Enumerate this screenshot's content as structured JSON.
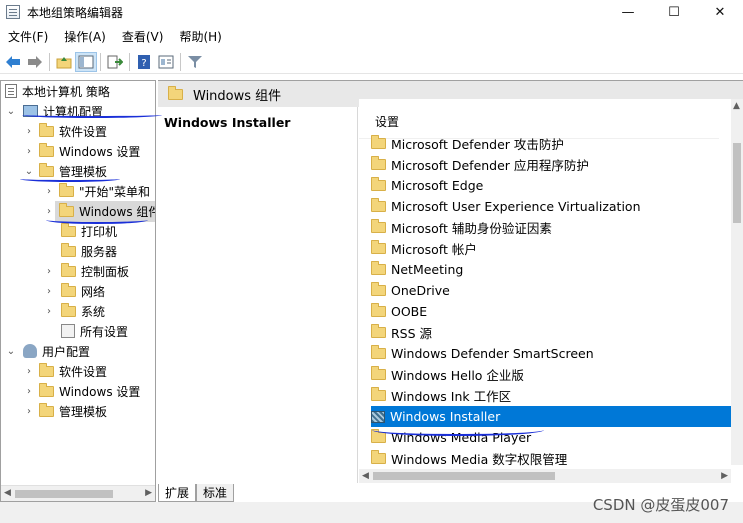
{
  "window": {
    "title": "本地组策略编辑器",
    "controls": [
      "—",
      "☐",
      "✕"
    ]
  },
  "menu": [
    "文件(F)",
    "操作(A)",
    "查看(V)",
    "帮助(H)"
  ],
  "toolbar": {
    "icons": [
      "back-arrow",
      "forward-arrow",
      "folder-up",
      "show-tree",
      "export-list",
      "help",
      "properties",
      "filter"
    ]
  },
  "tree": {
    "root": "本地计算机 策略",
    "computer_config": "计算机配置",
    "software_settings": "软件设置",
    "windows_settings": "Windows 设置",
    "admin_templates": "管理模板",
    "start_menu": "\"开始\"菜单和",
    "windows_components": "Windows 组件",
    "printers": "打印机",
    "server": "服务器",
    "control_panel": "控制面板",
    "network": "网络",
    "system": "系统",
    "all_settings": "所有设置",
    "user_config": "用户配置",
    "user_software_settings": "软件设置",
    "user_windows_settings": "Windows 设置",
    "user_admin_templates": "管理模板"
  },
  "right": {
    "path_title": "Windows 组件",
    "description_title": "Windows Installer",
    "column_header": "设置",
    "items": [
      "Microsoft Defender 攻击防护",
      "Microsoft Defender 应用程序防护",
      "Microsoft Edge",
      "Microsoft User Experience Virtualization",
      "Microsoft 辅助身份验证因素",
      "Microsoft 帐户",
      "NetMeeting",
      "OneDrive",
      "OOBE",
      "RSS 源",
      "Windows Defender SmartScreen",
      "Windows Hello 企业版",
      "Windows Ink 工作区",
      "Windows Installer",
      "Windows Media Player",
      "Windows Media 数字权限管理"
    ],
    "selected_item": "Windows Installer"
  },
  "tabs": [
    "扩展",
    "标准"
  ],
  "watermark": "CSDN @皮蛋皮007",
  "colors": {
    "selection": "#0078d7",
    "folder": "#f3d57a",
    "annotation_ink": "#1a2fd8"
  }
}
